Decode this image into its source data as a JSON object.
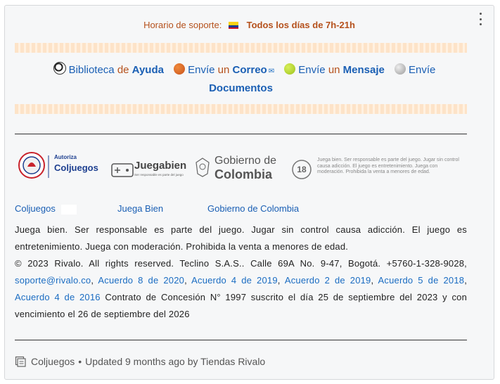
{
  "support": {
    "label": "Horario de soporte:",
    "hours": "Todos los días de 7h-21h",
    "flag_icon": "colombia-flag-icon"
  },
  "help_links": {
    "library": {
      "pre": "Biblioteca",
      "mid": "de",
      "bold": "Ayuda",
      "icon": "soccer-ball-icon"
    },
    "email": {
      "pre": "Envíe",
      "mid": "un",
      "bold": "Correo",
      "suffix": "✉",
      "icon": "basketball-icon"
    },
    "message": {
      "pre": "Envíe",
      "mid": "un",
      "bold": "Mensaje",
      "icon": "tennis-ball-icon"
    },
    "documents": {
      "pre": "Envíe",
      "bold": "Documentos",
      "icon": "volleyball-icon"
    }
  },
  "logos": {
    "coljuegos_authorize": "Autoriza",
    "coljuegos_name": "Coljuegos",
    "juega_bien": "Juegabien",
    "juega_bien_sub": "Ser responsable es parte del juego",
    "gobierno_line1": "Gobierno de",
    "gobierno_line2": "Colombia",
    "age": "18",
    "age_text": "Juega bien. Ser responsable es parte del juego. Jugar sin control causa adicción. El juego es entretenimiento. Juega con moderación. Prohibida la venta a menores de edad."
  },
  "footer_links": {
    "coljuegos": "Coljuegos",
    "juega_bien": "Juega Bien",
    "gobierno": "Gobierno de Colombia"
  },
  "legal": {
    "line1": "Juega bien. Ser responsable es parte del juego. Jugar sin control causa adicción. El juego es entretenimiento. Juega con moderación. Prohibida la venta a menores de edad.",
    "line2": "© 2023 Rivalo. All rights reserved. Teclino S.A.S.. Calle 69A No. 9-47, Bogotá. +5760-1-328-9028,",
    "email": "soporte@rivalo.co",
    "ac1": "Acuerdo 8 de 2020",
    "ac2": "Acuerdo 4 de 2019",
    "ac3": "Acuerdo 2 de 2019",
    "ac4": "Acuerdo 5 de 2018",
    "ac5": "Acuerdo 4 de 2016",
    "tail": "Contrato de Concesión N° 1997 suscrito el día 25 de septiembre del 2023 y con vencimiento el 26 de septiembre del 2026"
  },
  "meta": {
    "category": "Coljuegos",
    "separator": "•",
    "updated": "Updated 9 months ago by Tiendas Rivalo"
  },
  "colors": {
    "link": "#1a6cc2",
    "accent": "#b5511c",
    "stripe": "#fde3c8"
  }
}
